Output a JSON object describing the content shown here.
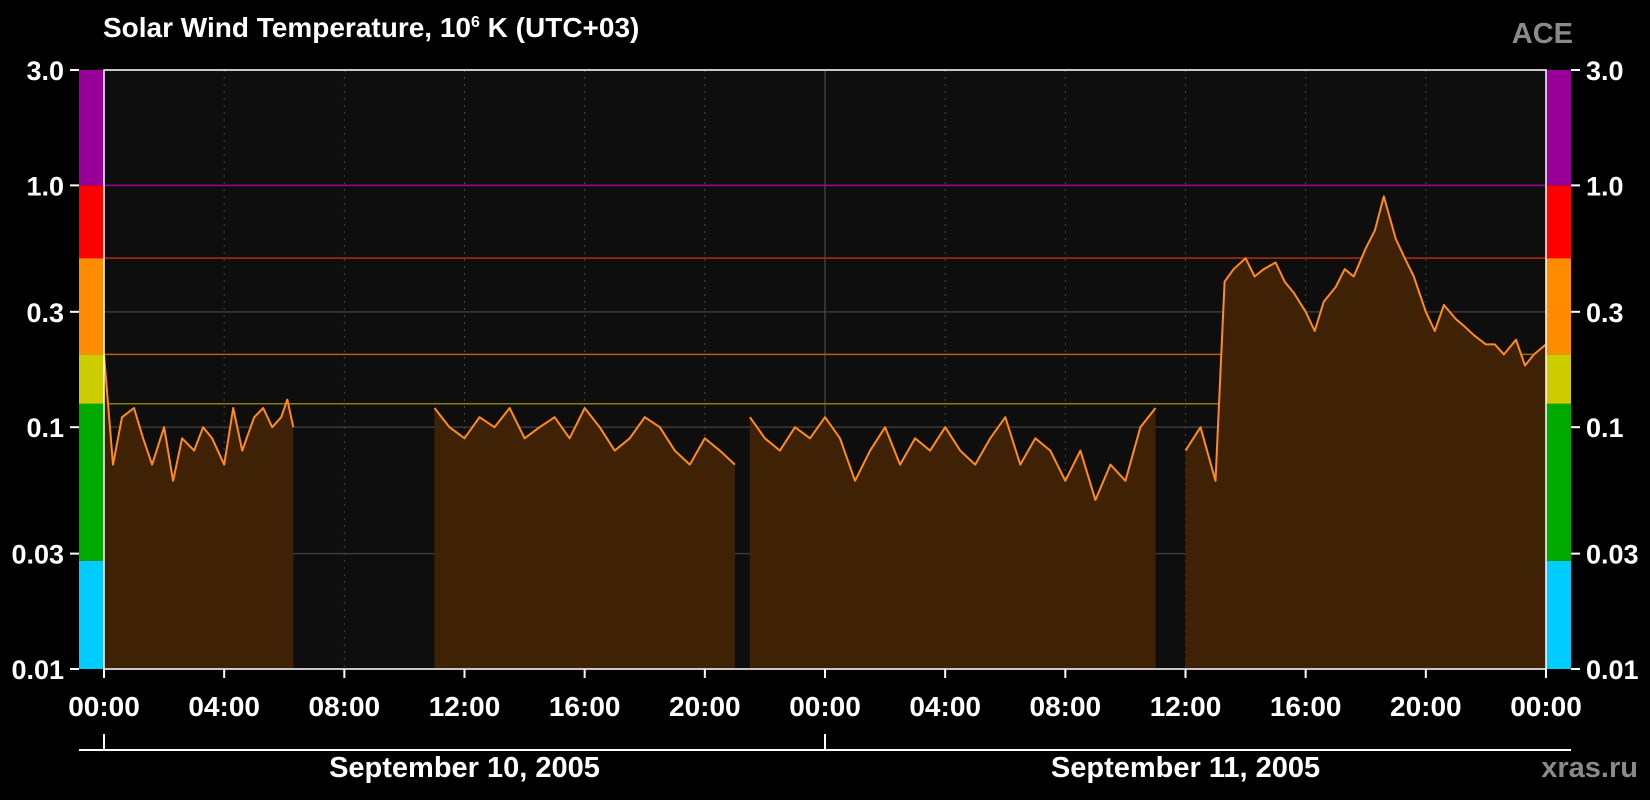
{
  "title_main": "Solar Wind Temperature, 10",
  "title_sup": "6",
  "title_rest": " K (UTC+03)",
  "source": "ACE",
  "watermark": "xras.ru",
  "dates": [
    {
      "label": "September 10, 2005",
      "center_hour": 12
    },
    {
      "label": "September 11, 2005",
      "center_hour": 36
    }
  ],
  "colors": {
    "background": "#000000",
    "plot_bg": "#0e0e0e",
    "grid": "#3a3a3a",
    "data_line": "#ff8c1a",
    "data_fill": "#3f2206",
    "level_purple": "#990099",
    "level_red": "#ff0000",
    "level_orange": "#ff8c00",
    "level_yellow": "#cccc00",
    "level_green": "#00aa00",
    "level_cyan": "#00ccff"
  },
  "chart_data": {
    "type": "area",
    "title": "Solar Wind Temperature, 10^6 K (UTC+03)",
    "xlabel": "",
    "ylabel": "",
    "y_scale": "log",
    "ylim": [
      0.01,
      3.0
    ],
    "y_ticks": [
      0.01,
      0.03,
      0.1,
      0.3,
      1.0,
      3.0
    ],
    "y_tick_labels": [
      "0.01",
      "0.03",
      "0.1",
      "0.3",
      "1.0",
      "3.0"
    ],
    "x_range_hours": [
      0,
      48
    ],
    "x_ticks_hours": [
      0,
      4,
      8,
      12,
      16,
      20,
      24,
      28,
      32,
      36,
      40,
      44,
      48
    ],
    "x_tick_labels": [
      "00:00",
      "04:00",
      "08:00",
      "12:00",
      "16:00",
      "20:00",
      "00:00",
      "04:00",
      "08:00",
      "12:00",
      "16:00",
      "20:00",
      "00:00"
    ],
    "grid": true,
    "level_bands": [
      {
        "from": 0.01,
        "to": 0.028,
        "color": "#00ccff"
      },
      {
        "from": 0.028,
        "to": 0.125,
        "color": "#00aa00"
      },
      {
        "from": 0.125,
        "to": 0.2,
        "color": "#cccc00"
      },
      {
        "from": 0.2,
        "to": 0.5,
        "color": "#ff8c00"
      },
      {
        "from": 0.5,
        "to": 1.0,
        "color": "#ff0000"
      },
      {
        "from": 1.0,
        "to": 3.0,
        "color": "#990099"
      }
    ],
    "threshold_lines": [
      {
        "value": 1.0,
        "color": "#990099"
      },
      {
        "value": 0.5,
        "color": "#b03010"
      },
      {
        "value": 0.2,
        "color": "#b06010"
      },
      {
        "value": 0.125,
        "color": "#8a7a10"
      }
    ],
    "series": [
      {
        "segments": [
          {
            "x": [
              0.0,
              0.3,
              0.6,
              1.0,
              1.3,
              1.6,
              2.0,
              2.3,
              2.6,
              3.0,
              3.3,
              3.6,
              4.0,
              4.3,
              4.6,
              5.0,
              5.3,
              5.6,
              5.9,
              6.1,
              6.3
            ],
            "y": [
              0.2,
              0.07,
              0.11,
              0.12,
              0.09,
              0.07,
              0.1,
              0.06,
              0.09,
              0.08,
              0.1,
              0.09,
              0.07,
              0.12,
              0.08,
              0.11,
              0.12,
              0.1,
              0.11,
              0.13,
              0.1
            ]
          },
          {
            "x": [
              11.0,
              11.5,
              12.0,
              12.5,
              13.0,
              13.5,
              14.0,
              14.5,
              15.0,
              15.5,
              16.0,
              16.5,
              17.0,
              17.5,
              18.0,
              18.5,
              19.0,
              19.5,
              20.0,
              20.5,
              21.0
            ],
            "y": [
              0.12,
              0.1,
              0.09,
              0.11,
              0.1,
              0.12,
              0.09,
              0.1,
              0.11,
              0.09,
              0.12,
              0.1,
              0.08,
              0.09,
              0.11,
              0.1,
              0.08,
              0.07,
              0.09,
              0.08,
              0.07
            ]
          },
          {
            "x": [
              21.5,
              22.0,
              22.5,
              23.0,
              23.5,
              24.0,
              24.5,
              25.0,
              25.5,
              26.0,
              26.5,
              27.0,
              27.5,
              28.0,
              28.5,
              29.0,
              29.5,
              30.0,
              30.5,
              31.0,
              31.5,
              32.0,
              32.5,
              33.0,
              33.5,
              34.0,
              34.5,
              35.0
            ],
            "y": [
              0.11,
              0.09,
              0.08,
              0.1,
              0.09,
              0.11,
              0.09,
              0.06,
              0.08,
              0.1,
              0.07,
              0.09,
              0.08,
              0.1,
              0.08,
              0.07,
              0.09,
              0.11,
              0.07,
              0.09,
              0.08,
              0.06,
              0.08,
              0.05,
              0.07,
              0.06,
              0.1,
              0.12
            ]
          },
          {
            "x": [
              36.0,
              36.5,
              37.0,
              37.3,
              37.6,
              38.0,
              38.3,
              38.6,
              39.0,
              39.3,
              39.6,
              40.0,
              40.3,
              40.6,
              41.0,
              41.3,
              41.6,
              42.0,
              42.3,
              42.6,
              43.0,
              43.3,
              43.6,
              44.0,
              44.3,
              44.6,
              45.0,
              45.3,
              45.6,
              46.0,
              46.3,
              46.6,
              47.0,
              47.3,
              47.6,
              48.0
            ],
            "y": [
              0.08,
              0.1,
              0.06,
              0.4,
              0.45,
              0.5,
              0.42,
              0.45,
              0.48,
              0.4,
              0.36,
              0.3,
              0.25,
              0.33,
              0.38,
              0.45,
              0.42,
              0.55,
              0.65,
              0.9,
              0.6,
              0.5,
              0.42,
              0.3,
              0.25,
              0.32,
              0.28,
              0.26,
              0.24,
              0.22,
              0.22,
              0.2,
              0.23,
              0.18,
              0.2,
              0.22
            ]
          }
        ]
      }
    ]
  }
}
